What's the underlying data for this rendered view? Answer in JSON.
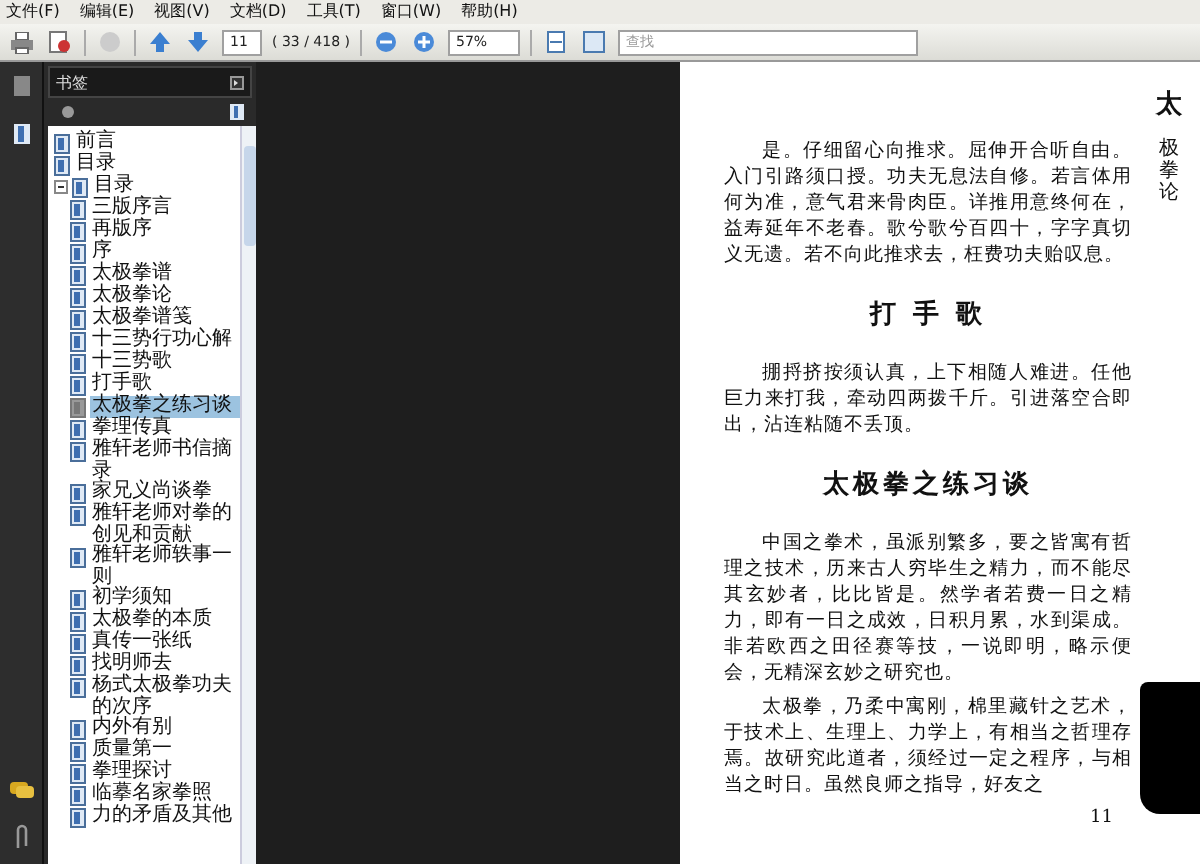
{
  "menu": [
    "文件(F)",
    "编辑(E)",
    "视图(V)",
    "文档(D)",
    "工具(T)",
    "窗口(W)",
    "帮助(H)"
  ],
  "toolbar": {
    "page": "11",
    "page_count": "( 33 / 418 )",
    "zoom": "57%",
    "search": {
      "placeholder": "查找"
    }
  },
  "bookmarks": {
    "title": "书签",
    "items": [
      {
        "label": "前言",
        "selected": false
      },
      {
        "label": "目录",
        "selected": false
      },
      {
        "label": "目录",
        "selected": false,
        "expanded": true,
        "children": [
          {
            "label": "三版序言",
            "selected": false
          },
          {
            "label": "再版序",
            "selected": false
          },
          {
            "label": "序",
            "selected": false
          },
          {
            "label": "太极拳谱",
            "selected": false
          },
          {
            "label": "太极拳论",
            "selected": false
          },
          {
            "label": "太极拳谱笺",
            "selected": false
          },
          {
            "label": "十三势行功心解",
            "selected": false
          },
          {
            "label": "十三势歌",
            "selected": false
          },
          {
            "label": "打手歌",
            "selected": false
          },
          {
            "label": "太极拳之练习谈",
            "selected": true
          },
          {
            "label": "拳理传真",
            "selected": false
          },
          {
            "label": "雅轩老师书信摘录",
            "selected": false
          },
          {
            "label": "家兄义尚谈拳",
            "selected": false
          },
          {
            "label": "雅轩老师对拳的创见和贡献",
            "selected": false
          },
          {
            "label": "雅轩老师轶事一则",
            "selected": false
          },
          {
            "label": "初学须知",
            "selected": false
          },
          {
            "label": "太极拳的本质",
            "selected": false
          },
          {
            "label": "真传一张纸",
            "selected": false
          },
          {
            "label": "找明师去",
            "selected": false
          },
          {
            "label": "杨式太极拳功夫的次序",
            "selected": false
          },
          {
            "label": "内外有别",
            "selected": false
          },
          {
            "label": "质量第一",
            "selected": false
          },
          {
            "label": "拳理探讨",
            "selected": false
          },
          {
            "label": "临摹名家拳照",
            "selected": false
          },
          {
            "label": "力的矛盾及其他",
            "selected": false
          }
        ]
      }
    ]
  },
  "page": {
    "side_mark": "太",
    "side_caption": "极拳论",
    "blocks": [
      {
        "kind": "paragraph",
        "text": "是。仔细留心向推求。屈伸开合听自由。入门引路须口授。功夫无息法自修。若言体用何为准，意气君来骨肉臣。详推用意终何在，益寿延年不老春。歌兮歌兮百四十，字字真切义无遗。若不向此推求去，枉费功夫贻叹息。"
      },
      {
        "kind": "heading",
        "text": "打 手 歌"
      },
      {
        "kind": "paragraph",
        "text": "掤捋挤按须认真，上下相随人难进。任他巨力来打我，牵动四两拨千斤。引进落空合即出，沾连粘随不丢顶。"
      },
      {
        "kind": "heading",
        "text": "太极拳之练习谈"
      },
      {
        "kind": "paragraph",
        "text": "中国之拳术，虽派别繁多，要之皆寓有哲理之技术，历来古人穷毕生之精力，而不能尽其玄妙者，比比皆是。然学者若费一日之精力，即有一日之成效，日积月累，水到渠成。非若欧西之田径赛等技，一说即明，略示便会，无精深玄妙之研究也。"
      },
      {
        "kind": "paragraph",
        "text": "太极拳，乃柔中寓刚，棉里藏针之艺术，于技术上、生理上、力学上，有相当之哲理存焉。故研究此道者，须经过一定之程序，与相当之时日。虽然良师之指导，好友之"
      }
    ],
    "page_number": "11"
  }
}
